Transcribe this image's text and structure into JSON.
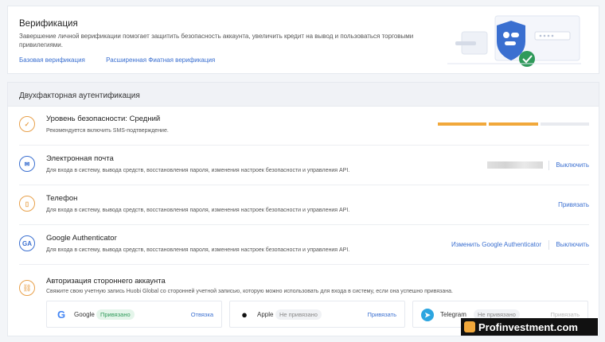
{
  "verification": {
    "title": "Верификация",
    "description": "Завершение личной верификации помогает защитить безопасность аккаунта, увеличить кредит на вывод и пользоваться торговыми привилегиями.",
    "links": [
      "Базовая верификация",
      "Расширенная Фиатная верификация"
    ]
  },
  "twofa": {
    "header": "Двухфакторная аутентификация",
    "security": {
      "label": "Уровень безопасности:",
      "level": "Средний",
      "hint": "Рекомендуется включить SMS-подтверждение.",
      "level_filled": 2,
      "level_total": 3,
      "color": "#f1a83b"
    },
    "email": {
      "name": "Электронная почта",
      "desc": "Для входа в систему, вывода средств, восстановления пароля, изменения настроек безопасности и управления API.",
      "action": "Выключить"
    },
    "phone": {
      "name": "Телефон",
      "desc": "Для входа в систему, вывода средств, восстановления пароля, изменения настроек безопасности и управления API.",
      "action": "Привязать"
    },
    "ga": {
      "name": "Google Authenticator",
      "icon_text": "GA",
      "desc": "Для входа в систему, вывода средств, восстановления пароля, изменения настроек безопасности и управления API.",
      "action_change": "Изменить Google Authenticator",
      "action_off": "Выключить"
    },
    "third_party": {
      "name": "Авторизация стороннего аккаунта",
      "desc": "Свяжите свою учетную запись Huobi Global со сторонней учетной записью, которую можно использовать для входа в систему, если она успешно привязана.",
      "providers": [
        {
          "name": "Google",
          "status": "Привязано",
          "action": "Отвязка"
        },
        {
          "name": "Apple",
          "status": "Не привязано",
          "action": "Привязать"
        },
        {
          "name": "Telegram",
          "status": "Не привязано",
          "action": "Привязать"
        }
      ]
    }
  },
  "watermark": "Profinvestment.com"
}
